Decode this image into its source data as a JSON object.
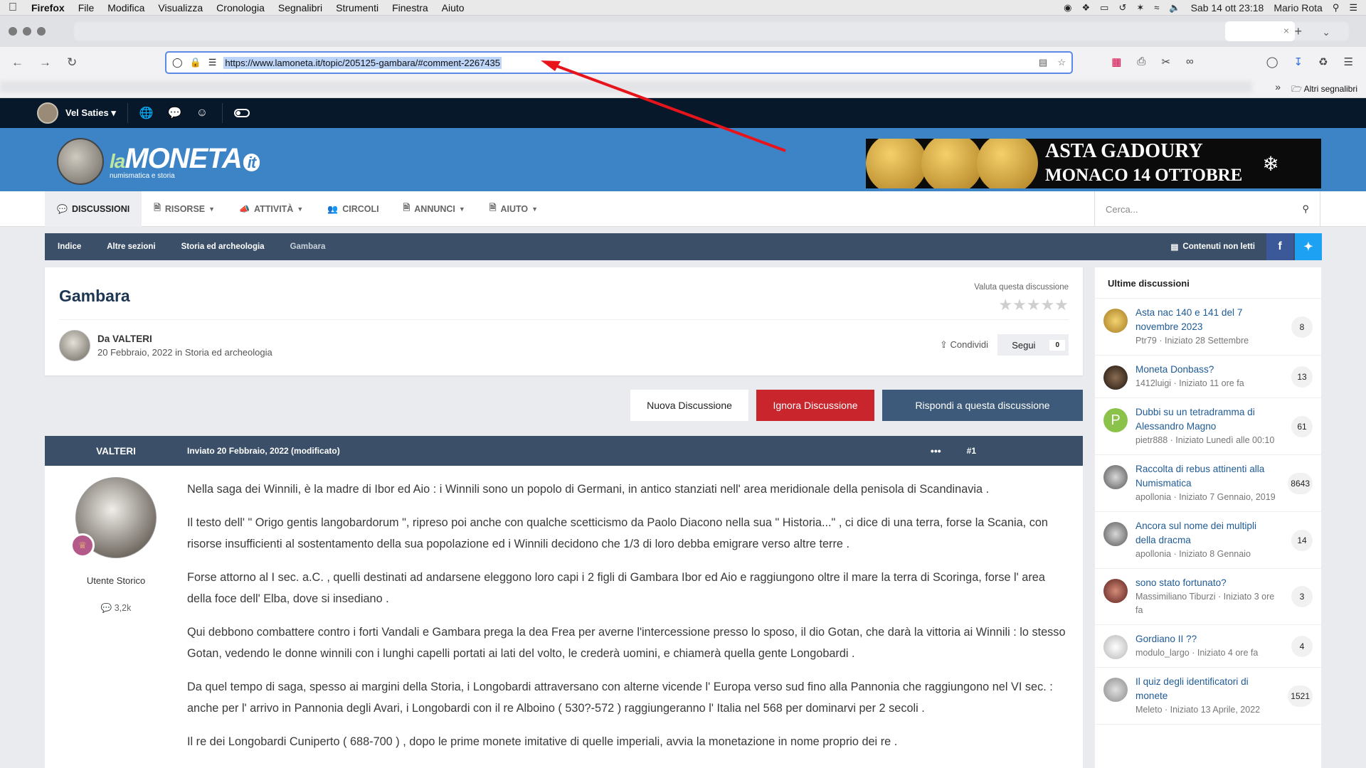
{
  "menubar": {
    "app": "Firefox",
    "items": [
      "File",
      "Modifica",
      "Visualizza",
      "Cronologia",
      "Segnalibri",
      "Strumenti",
      "Finestra",
      "Aiuto"
    ],
    "datetime": "Sab 14 ott  23:18",
    "user": "Mario Rota"
  },
  "browser": {
    "url": "https://www.lamoneta.it/topic/205125-gambara/#comment-2267435",
    "bookmarks_other": "Altri segnalibri"
  },
  "site": {
    "username": "Vel Saties",
    "logo_main": "MONETA",
    "logo_la": "la",
    "logo_it": "it",
    "logo_sub": "numismatica e storia",
    "banner_line1": "ASTA GADOURY",
    "banner_line2": "MONACO 14 OTTOBRE"
  },
  "nav": {
    "items": [
      "Discussioni",
      "Risorse",
      "Attività",
      "Circoli",
      "Annunci",
      "Aiuto"
    ],
    "search_placeholder": "Cerca..."
  },
  "breadcrumb": {
    "items": [
      "Indice",
      "Altre sezioni",
      "Storia ed archeologia",
      "Gambara"
    ],
    "unread": "Contenuti non letti"
  },
  "topic": {
    "title": "Gambara",
    "rate_label": "Valuta questa discussione",
    "author": "Da VALTERI",
    "meta": "20 Febbraio, 2022 in Storia ed archeologia",
    "share": "Condividi",
    "follow": "Segui",
    "follow_count": "0"
  },
  "buttons": {
    "new": "Nuova Discussione",
    "ignore": "Ignora Discussione",
    "reply": "Rispondi a questa discussione"
  },
  "post": {
    "author": "VALTERI",
    "date": "Inviato 20 Febbraio, 2022 (modificato)",
    "number": "#1",
    "role": "Utente Storico",
    "count": "3,2k",
    "paragraphs": [
      "Nella saga dei Winnili, è la madre di Ibor ed Aio : i  Winnili sono un popolo di Germani, in antico stanziati nell' area meridionale della penisola di Scandinavia .",
      "Il testo dell' \" Origo gentis langobardorum \", ripreso poi anche con qualche scetticismo da Paolo Diacono nella sua \" Historia...\" , ci dice di una terra, forse la Scania, con risorse insufficienti al sostentamento della sua popolazione  ed i Winnili decidono che 1/3 di loro debba emigrare verso altre terre .",
      "Forse attorno al I sec. a.C. , quelli destinati ad andarsene eleggono loro capi i 2 figli di Gambara Ibor ed Aio e raggiungono oltre il mare la terra di Scoringa, forse l' area della foce dell' Elba, dove si insediano .",
      "Qui debbono combattere contro i forti Vandali e Gambara prega la dea Frea per averne l'intercessione presso lo sposo, il dio Gotan, che darà la vittoria ai Winnili : lo stesso Gotan, vedendo le donne winnili con i lunghi capelli portati ai lati del volto, le crederà uomini, e chiamerà quella gente  Longobardi .",
      "Da quel tempo di saga, spesso ai margini della Storia, i Longobardi attraversano con alterne vicende l' Europa verso sud fino alla Pannonia che raggiungono nel VI sec. : anche per l' arrivo in Pannonia degli Avari, i Longobardi con il re Alboino ( 530?-572 ) raggiungeranno l' Italia nel 568 per dominarvi per 2 secoli .",
      "Il re dei Longobardi Cuniperto ( 688-700 ) , dopo le prime monete imitative di quelle imperiali, avvia la monetazione in nome proprio dei re ."
    ]
  },
  "sidebar": {
    "title": "Ultime discussioni",
    "items": [
      {
        "title": "Asta nac 140 e 141 del 7 novembre 2023",
        "meta": "Ptr79 · Iniziato 28 Settembre",
        "count": "8"
      },
      {
        "title": "Moneta Donbass?",
        "meta": "1412luigi · Iniziato 11 ore fa",
        "count": "13"
      },
      {
        "title": "Dubbi su un tetradramma di Alessandro Magno",
        "meta": "pietr888 · Iniziato Lunedì alle 00:10",
        "count": "61",
        "initial": "P"
      },
      {
        "title": "Raccolta di rebus attinenti alla Numismatica",
        "meta": "apollonia · Iniziato 7 Gennaio, 2019",
        "count": "8643"
      },
      {
        "title": "Ancora sul nome dei multipli della dracma",
        "meta": "apollonia · Iniziato 8 Gennaio",
        "count": "14"
      },
      {
        "title": "sono stato fortunato?",
        "meta": "Massimiliano Tiburzi · Iniziato 3 ore fa",
        "count": "3"
      },
      {
        "title": "Gordiano II ??",
        "meta": "modulo_largo · Iniziato 4 ore fa",
        "count": "4"
      },
      {
        "title": "Il quiz degli identificatori di monete",
        "meta": "Meleto · Iniziato 13 Aprile, 2022",
        "count": "1521"
      }
    ]
  },
  "colors": {
    "header_blue": "#3d84c6",
    "dark_bar": "#07182a",
    "crumb": "#3b5068",
    "ignore_red": "#c8252c",
    "arrow": "#e8141c"
  }
}
